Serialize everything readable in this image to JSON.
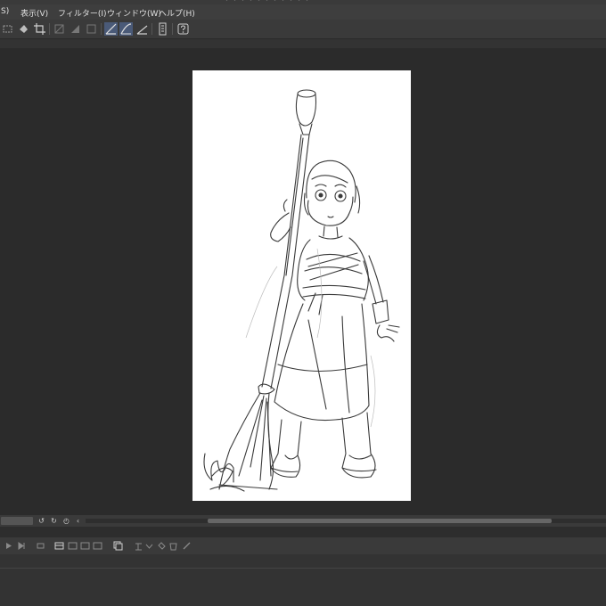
{
  "window": {
    "title": "・・・・・・・・・・・"
  },
  "menubar": {
    "items": [
      {
        "id": "s",
        "label": "S)"
      },
      {
        "id": "view",
        "label": "表示(V)"
      },
      {
        "id": "filter",
        "label": "フィルター(I)"
      },
      {
        "id": "window",
        "label": "ウィンドウ(W)"
      },
      {
        "id": "help",
        "label": "ヘルプ(H)"
      }
    ]
  },
  "toolbar": {
    "icons": [
      "selection-tool-icon",
      "fill-icon",
      "crop-icon",
      "hide-selection-icon",
      "mask-icon",
      "square-icon",
      "snap-ruler-icon",
      "snap-special-ruler-icon",
      "snap-grid-icon",
      "ruler-icon",
      "help-icon"
    ],
    "active": [
      "snap-ruler-icon"
    ]
  },
  "canvas": {
    "background": "#ffffff"
  },
  "navigator": {
    "zoom_value": "",
    "icons": [
      "rotate-left-icon",
      "rotate-right-icon",
      "reset-rotation-icon",
      "flip-icon"
    ]
  },
  "layer_toolbar": {
    "icons": [
      "play-icon",
      "skip-icon",
      "loop-icon",
      "new-raster-layer-icon",
      "new-vector-layer-icon",
      "new-folder-icon",
      "copy-layer-icon",
      "merge-icon",
      "transfer-icon",
      "link-icon",
      "delete-layer-icon",
      "clear-icon",
      "pen-icon"
    ]
  },
  "colors": {
    "background": "#2b2b2b",
    "menubar": "#3e3e3e",
    "toolbar": "#3a3a3a",
    "accent": "#4a5a78"
  }
}
